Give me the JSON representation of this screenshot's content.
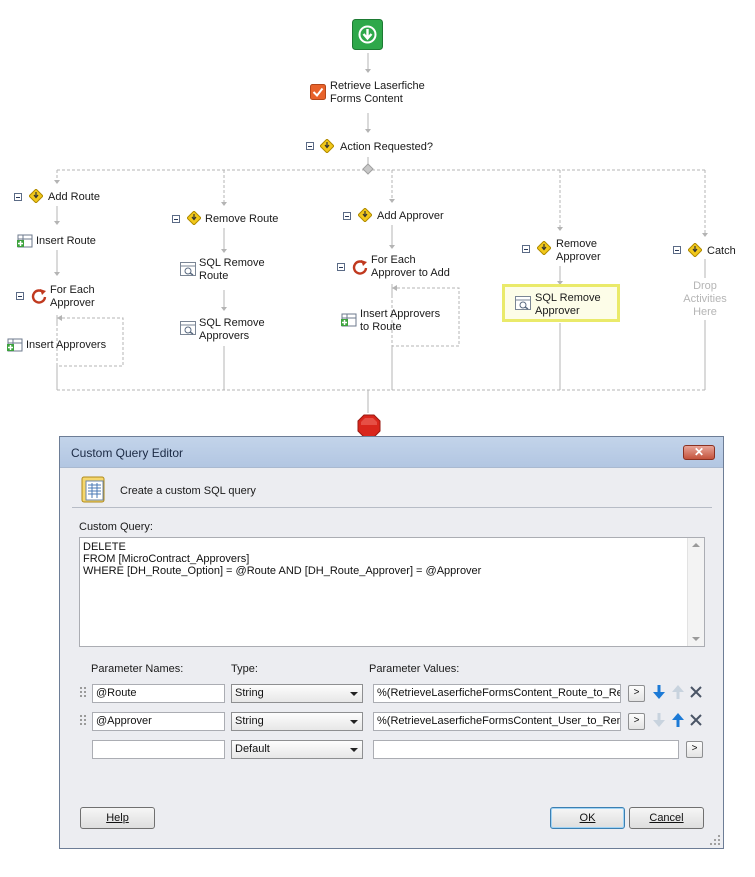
{
  "workflow": {
    "start_icon": "down-arrow-start-icon",
    "retrieve": "Retrieve Laserfiche\nForms Content",
    "decision": "Action Requested?",
    "branches": {
      "add_route": {
        "label": "Add Route",
        "insert_route": "Insert Route",
        "for_each": "For Each\nApprover",
        "insert_approvers": "Insert Approvers"
      },
      "remove_route": {
        "label": "Remove Route",
        "sql_remove_route": "SQL Remove\nRoute",
        "sql_remove_approvers": "SQL Remove\nApprovers"
      },
      "add_approver": {
        "label": "Add Approver",
        "for_each": "For Each\nApprover to Add",
        "insert_approvers": "Insert Approvers\nto Route"
      },
      "remove_approver": {
        "label": "Remove\nApprover",
        "sql_remove_approver": "SQL Remove\nApprover"
      },
      "catch": {
        "label": "Catch",
        "drop_text": "Drop\nActivities\nHere"
      }
    },
    "stop_icon": "stop-octagon-icon"
  },
  "dialog": {
    "title": "Custom Query Editor",
    "close_label": "✕",
    "subtitle": "Create a custom SQL query",
    "query_label": "Custom Query:",
    "query_text": "DELETE\nFROM [MicroContract_Approvers]\nWHERE [DH_Route_Option] = @Route AND [DH_Route_Approver] = @Approver",
    "columns": {
      "names": "Parameter Names:",
      "type": "Type:",
      "values": "Parameter Values:"
    },
    "params": [
      {
        "name": "@Route",
        "type": "String",
        "value": "%(RetrieveLaserficheFormsContent_Route_to_Re"
      },
      {
        "name": "@Approver",
        "type": "String",
        "value": "%(RetrieveLaserficheFormsContent_User_to_Rem"
      },
      {
        "name": "",
        "type": "Default",
        "value": ""
      }
    ],
    "token_button": ">",
    "help": "Help",
    "ok": "OK",
    "cancel": "Cancel"
  },
  "colors": {
    "start_green": "#2ea84a",
    "stop_red": "#d9261c",
    "decision_yellow": "#f2c81a",
    "highlight_yellow": "#eaea6a",
    "arrow_blue": "#1c7ad6"
  }
}
